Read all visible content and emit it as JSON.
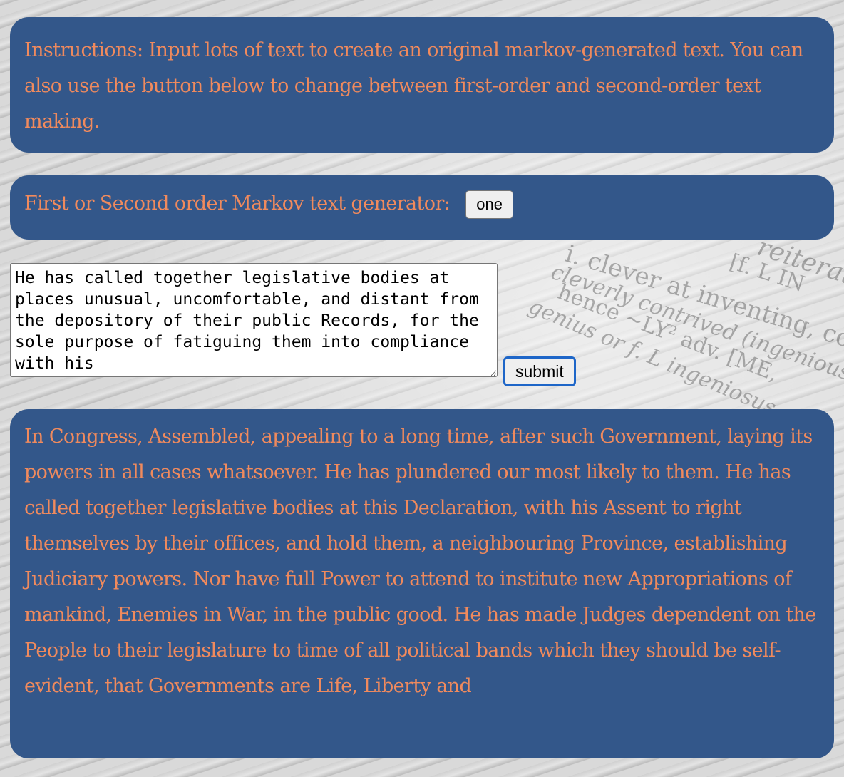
{
  "instructions": {
    "text": "Instructions: Input lots of text to create an original markov-generated text. You can also use the button below to change between first-order and second-order text making."
  },
  "order_toggle": {
    "label": "First or Second order Markov text generator:",
    "button_label": "one"
  },
  "input": {
    "value": "He has called together legislative bodies at places unusual, uncomfortable, and distant from the depository of their public Records, for the sole purpose of fatiguing them into compliance with his"
  },
  "submit": {
    "label": "submit"
  },
  "output": {
    "text": "In Congress, Assembled, appealing to a long time, after such Government, laying its powers in all cases whatsoever. He has plundered our most likely to them. He has called together legislative bodies at this Declaration, with his Assent to right themselves by their offices, and hold them, a neighbouring Province, establishing Judiciary powers. Nor have full Power to attend to institute new Appropriations of mankind, Enemies in War, in the public good. He has made Judges dependent on the People to their legislature to time of all political bands which they should be self-evident, that Governments are Life, Liberty and"
  },
  "background": {
    "visible_words": [
      "i. clever at inventing, constructi",
      "cleverly contrived (ingenious machine",
      "hence  ~LY² adv.  [ME,",
      "genius or f. L ingeniosus",
      "reiterat",
      "[f. L  IN"
    ]
  },
  "colors": {
    "panel_bg": "#33578a",
    "panel_text": "#f08a5d",
    "submit_focus_border": "#1e66c8"
  }
}
